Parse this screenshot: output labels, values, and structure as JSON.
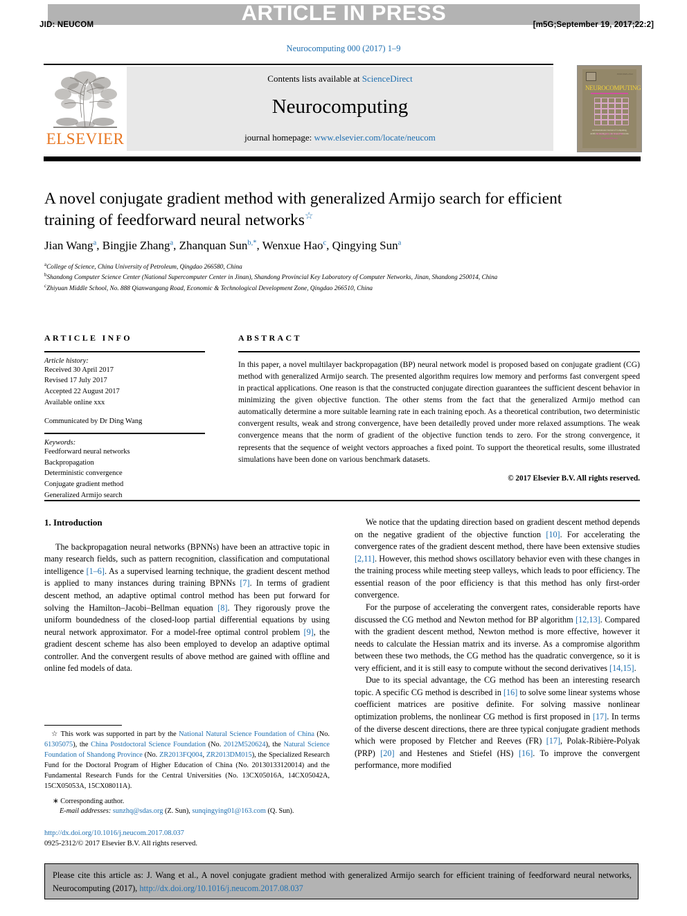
{
  "header": {
    "banner_text": "ARTICLE IN PRESS",
    "jid": "JID: NEUCOM",
    "build_stamp": "[m5G;September 19, 2017;22:2]",
    "journal_ref": "Neurocomputing 000 (2017) 1–9"
  },
  "masthead": {
    "contents_prefix": "Contents lists available at ",
    "contents_link": "ScienceDirect",
    "journal_name": "Neurocomputing",
    "homepage_prefix": "journal homepage: ",
    "homepage_link": "www.elsevier.com/locate/neucom",
    "publisher": "ELSEVIER",
    "cover": {
      "title": "NEUROCOMPUTING",
      "code": "ISSN 0925-2312",
      "blurb": "An International Journal\nof Computing, Artificial Intelligence\nand Neural Networks",
      "bottom": "Editor-in-Chief:\nTom Heskes",
      "imprint": "AVAILABLE ONLINE\nScienceDirect"
    }
  },
  "article": {
    "title": "A novel conjugate gradient method with generalized Armijo search for efficient training of feedforward neural networks",
    "title_marker": "☆",
    "authors_html": "Jian Wang<sup>a</sup>, Bingjie Zhang<sup>a</sup>, Zhanquan Sun<sup>b,</sup><sup>*</sup>, Wenxue Hao<sup>c</sup>, Qingying Sun<sup>a</sup>",
    "affiliations": [
      {
        "marker": "a",
        "text": "College of Science, China University of Petroleum, Qingdao 266580, China"
      },
      {
        "marker": "b",
        "text": "Shandong Computer Science Center (National Supercomputer Center in Jinan), Shandong Provincial Key Laboratory of Computer Networks, Jinan, Shandong 250014, China"
      },
      {
        "marker": "c",
        "text": "Zhiyuan Middle School, No. 888 Qianwangang Road, Economic & Technological Development Zone, Qingdao 266510, China"
      }
    ]
  },
  "article_info": {
    "heading": "ARTICLE INFO",
    "history_label": "Article history:",
    "history": [
      "Received 30 April 2017",
      "Revised 17 July 2017",
      "Accepted 22 August 2017",
      "Available online xxx"
    ],
    "communicated": "Communicated by Dr Ding Wang",
    "keywords_label": "Keywords:",
    "keywords": [
      "Feedforward neural networks",
      "Backpropagation",
      "Deterministic convergence",
      "Conjugate gradient method",
      "Generalized Armijo search"
    ]
  },
  "abstract": {
    "heading": "ABSTRACT",
    "body": "In this paper, a novel multilayer backpropagation (BP) neural network model is proposed based on conjugate gradient (CG) method with generalized Armijo search. The presented algorithm requires low memory and performs fast convergent speed in practical applications. One reason is that the constructed conjugate direction guarantees the sufficient descent behavior in minimizing the given objective function. The other stems from the fact that the generalized Armijo method can automatically determine a more suitable learning rate in each training epoch. As a theoretical contribution, two deterministic convergent results, weak and strong convergence, have been detailedly proved under more relaxed assumptions. The weak convergence means that the norm of gradient of the objective function tends to zero. For the strong convergence, it represents that the sequence of weight vectors approaches a fixed point. To support the theoretical results, some illustrated simulations have been done on various benchmark datasets.",
    "copyright": "© 2017 Elsevier B.V. All rights reserved."
  },
  "body": {
    "section_heading": "1. Introduction",
    "left_paragraphs": [
      "The backpropagation neural networks (BPNNs) have been an attractive topic in many research fields, such as pattern recognition, classification and computational intelligence [1–6]. As a supervised learning technique, the gradient descent method is applied to many instances during training BPNNs [7]. In terms of gradient descent method, an adaptive optimal control method has been put forward for solving the Hamilton–Jacobi–Bellman equation [8]. They rigorously prove the uniform boundedness of the closed-loop partial differential equations by using neural network approximator. For a model-free optimal control problem [9], the gradient descent scheme has also been employed to develop an adaptive optimal controller. And the convergent results of above method are gained with offline and online fed models of data."
    ],
    "right_paragraphs": [
      "We notice that the updating direction based on gradient descent method depends on the negative gradient of the objective function [10]. For accelerating the convergence rates of the gradient descent method, there have been extensive studies [2,11]. However, this method shows oscillatory behavior even with these changes in the training process while meeting steep valleys, which leads to poor efficiency. The essential reason of the poor efficiency is that this method has only first-order convergence.",
      "For the purpose of accelerating the convergent rates, considerable reports have discussed the CG method and Newton method for BP algorithm [12,13]. Compared with the gradient descent method, Newton method is more effective, however it needs to calculate the Hessian matrix and its inverse. As a compromise algorithm between these two methods, the CG method has the quadratic convergence, so it is very efficient, and it is still easy to compute without the second derivatives [14,15].",
      "Due to its special advantage, the CG method has been an interesting research topic. A specific CG method is described in [16] to solve some linear systems whose coefficient matrices are positive definite. For solving massive nonlinear optimization problems, the nonlinear CG method is first proposed in [17]. In terms of the diverse descent directions, there are three typical conjugate gradient methods which were proposed by Fletcher and Reeves (FR) [17], Polak-Ribière-Polyak (PRP) [20] and Hestenes and Stiefel (HS) [16]. To improve the convergent performance, more modified"
    ]
  },
  "footnotes": {
    "funding": "This work was supported in part by the National Natural Science Foundation of China (No. 61305075), the China Postdoctoral Science Foundation (No. 2012M520624), the Natural Science Foundation of Shandong Province (No. ZR2013FQ004, ZR2013DM015), the Specialized Research Fund for the Doctoral Program of Higher Education of China (No. 20130133120014) and the Fundamental Research Funds for the Central Universities (No. 13CX05016A, 14CX05042A, 15CX05053A, 15CX08011A).",
    "corresponding": "Corresponding author.",
    "email_label": "E-mail addresses:",
    "emails": [
      {
        "address": "sunzhq@sdas.org",
        "who": "(Z. Sun)"
      },
      {
        "address": "sunqingying01@163.com",
        "who": "(Q. Sun)"
      }
    ],
    "doi": "http://dx.doi.org/10.1016/j.neucom.2017.08.037",
    "issn_line": "0925-2312/© 2017 Elsevier B.V. All rights reserved."
  },
  "cite_box": {
    "prefix": "Please cite this article as: J. Wang et al., A novel conjugate gradient method with generalized Armijo search for efficient training of feedforward neural networks, Neurocomputing (2017), ",
    "link": "http://dx.doi.org/10.1016/j.neucom.2017.08.037"
  },
  "colors": {
    "link": "#1f6fb0",
    "banner_gray": "#b3b3b3",
    "panel_gray": "#e8e8e8",
    "elsevier_orange": "#e87722"
  }
}
